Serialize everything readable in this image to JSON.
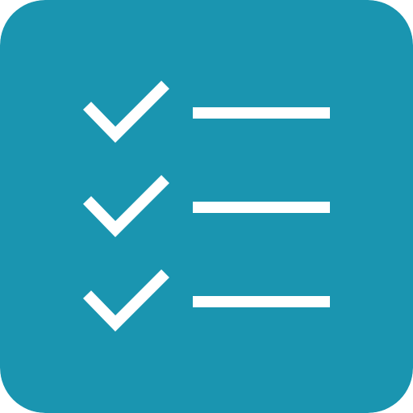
{
  "icon": {
    "name": "checklist-app-icon",
    "background_color": "#1A95B0",
    "foreground_color": "#FFFFFF",
    "rows": [
      {
        "checked": true,
        "check_icon": "checkmark-icon",
        "line_icon": "list-line"
      },
      {
        "checked": true,
        "check_icon": "checkmark-icon",
        "line_icon": "list-line"
      },
      {
        "checked": true,
        "check_icon": "checkmark-icon",
        "line_icon": "list-line"
      }
    ]
  }
}
